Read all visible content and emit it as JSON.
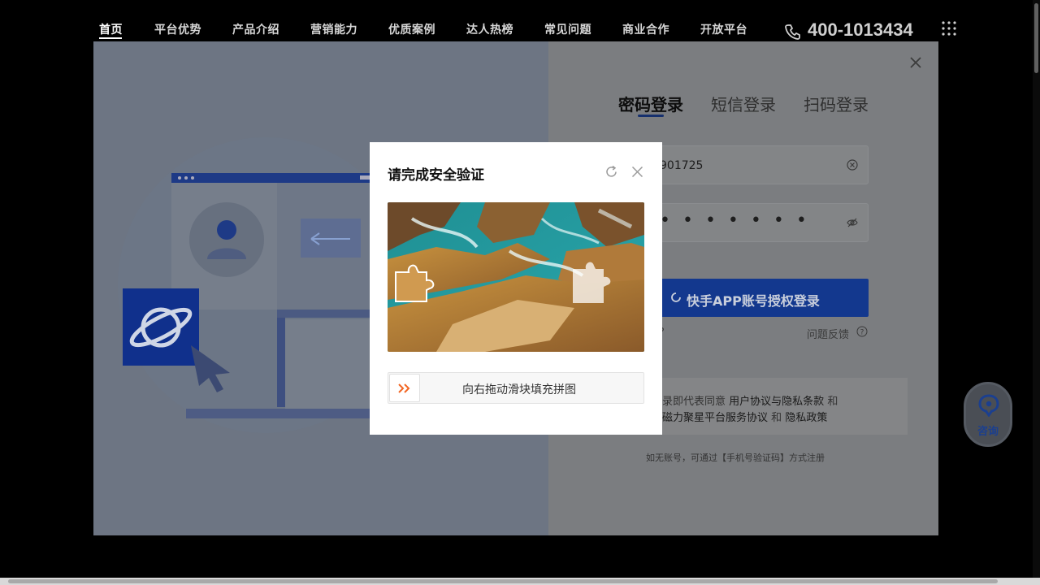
{
  "nav": {
    "items": [
      "首页",
      "平台优势",
      "产品介绍",
      "营销能力",
      "优质案例",
      "达人热榜",
      "常见问题",
      "商业合作",
      "开放平台"
    ],
    "phone": "400-1013434"
  },
  "login": {
    "tabs": [
      "密码登录",
      "短信登录",
      "扫码登录"
    ],
    "account_value": "901725",
    "password_value": "• • • • • • •",
    "kuaishou_button": "快手APP账号授权登录",
    "forgot_fragment": "?",
    "feedback": "问题反馈",
    "agreement": {
      "line1_prefix": "录即代表同意",
      "user_agreement": "用户协议与隐私条款",
      "and1": "和",
      "line2_prefix": "磁力聚星平台服务协议",
      "and2": "和",
      "privacy": "隐私政策"
    },
    "register_note": "如无账号，可通过【手机号验证码】方式注册"
  },
  "consult": {
    "label": "咨询"
  },
  "captcha": {
    "title": "请完成安全验证",
    "slider_hint": "向右拖动滑块填充拼图"
  },
  "colors": {
    "accent": "#1d55d8",
    "slider_arrow": "#f26522"
  }
}
